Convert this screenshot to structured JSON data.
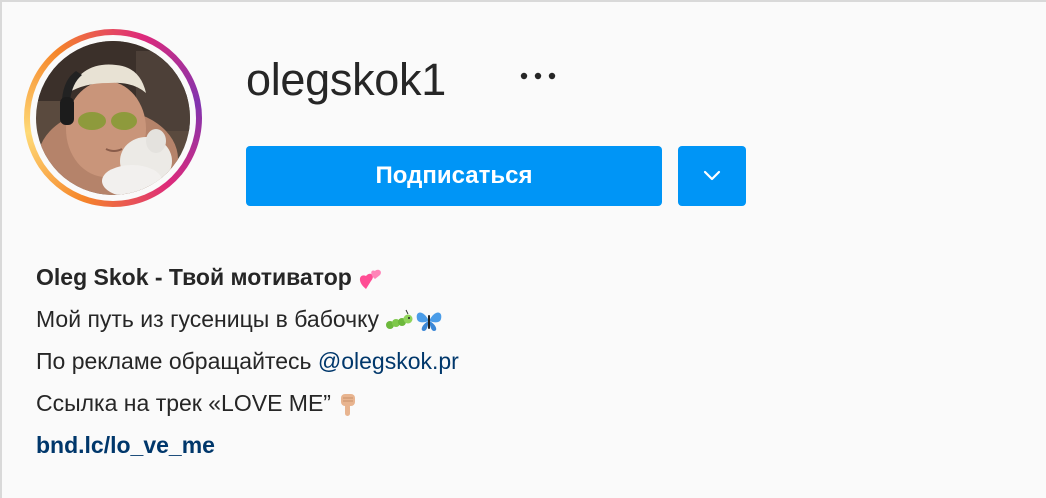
{
  "profile": {
    "username": "olegskok1",
    "more_icon": "more-horizontal-icon",
    "follow_label": "Подписаться",
    "dropdown_icon": "chevron-down-icon"
  },
  "bio": {
    "name": "Oleg Skok - Твой мотиватор",
    "line2": "Мой путь из гусеницы в бабочку",
    "line3_prefix": "По рекламе обращайтесь",
    "mention": "@olegskok.pr",
    "line4": "Ссылка на трек «LOVE ME”",
    "link": "bnd.lc/lo_ve_me"
  },
  "colors": {
    "accent": "#0095f6",
    "link": "#00376b",
    "text": "#262626",
    "background": "#fafafa"
  }
}
